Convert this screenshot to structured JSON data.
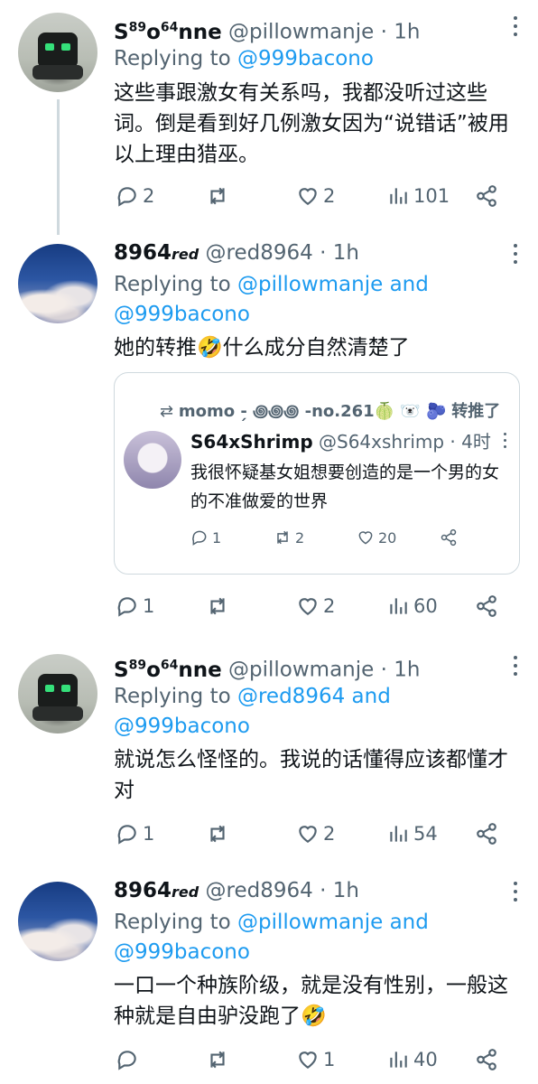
{
  "tweets": [
    {
      "name": "S",
      "name_sup1": "89",
      "name_mid": "o",
      "name_sup2": "64",
      "name_end": "nne",
      "handle": "@pillowmanje",
      "time": "· 1h",
      "reply_prefix": "Replying to",
      "reply_to": "@999bacono",
      "reply_and": "",
      "reply_to2": "",
      "body": "这些事跟激女有关系吗，我都没听过这些词。倒是看到好几例激女因为“说错话”被用以上理由猎巫。",
      "replies": "2",
      "retweets": "",
      "likes": "2",
      "views": "101"
    },
    {
      "name": "8964",
      "name_suffix": "red",
      "handle": "@red8964",
      "time": "· 1h",
      "reply_prefix": "Replying to",
      "reply_to": "@pillowmanje",
      "reply_and": "and",
      "reply_to2": "@999bacono",
      "body": "她的转推🤣什么成分自然清楚了",
      "replies": "1",
      "retweets": "",
      "likes": "2",
      "views": "60",
      "quote": {
        "retweeter": "momo -̗ ꩜꩜꩜ -no.261🍈 🐻‍❄️ 🫐",
        "retweet_label": "转推了",
        "name": "S64xShrimp",
        "handle": "@S64xshrimp",
        "time": "· 4时",
        "body": "我很怀疑基女姐想要创造的是一个男的女的不准做爱的世界",
        "replies": "1",
        "retweets": "2",
        "likes": "20"
      }
    },
    {
      "name": "S",
      "name_sup1": "89",
      "name_mid": "o",
      "name_sup2": "64",
      "name_end": "nne",
      "handle": "@pillowmanje",
      "time": "· 1h",
      "reply_prefix": "Replying to",
      "reply_to": "@red8964",
      "reply_and": "and",
      "reply_to2": "@999bacono",
      "body": "就说怎么怪怪的。我说的话懂得应该都懂才对",
      "replies": "1",
      "retweets": "",
      "likes": "2",
      "views": "54"
    },
    {
      "name": "8964",
      "name_suffix": "red",
      "handle": "@red8964",
      "time": "· 1h",
      "reply_prefix": "Replying to",
      "reply_to": "@pillowmanje",
      "reply_and": "and",
      "reply_to2": "@999bacono",
      "body": "一口一个种族阶级，就是没有性别，一般这种就是自由驴没跑了🤣",
      "replies": "",
      "retweets": "",
      "likes": "1",
      "views": "40"
    }
  ],
  "colors": {
    "accent": "#1d9bf0",
    "secondary_text": "#536471",
    "line": "#cfd9de"
  },
  "icons": [
    "reply-icon",
    "retweet-icon",
    "like-icon",
    "views-icon",
    "share-icon",
    "more-icon"
  ]
}
